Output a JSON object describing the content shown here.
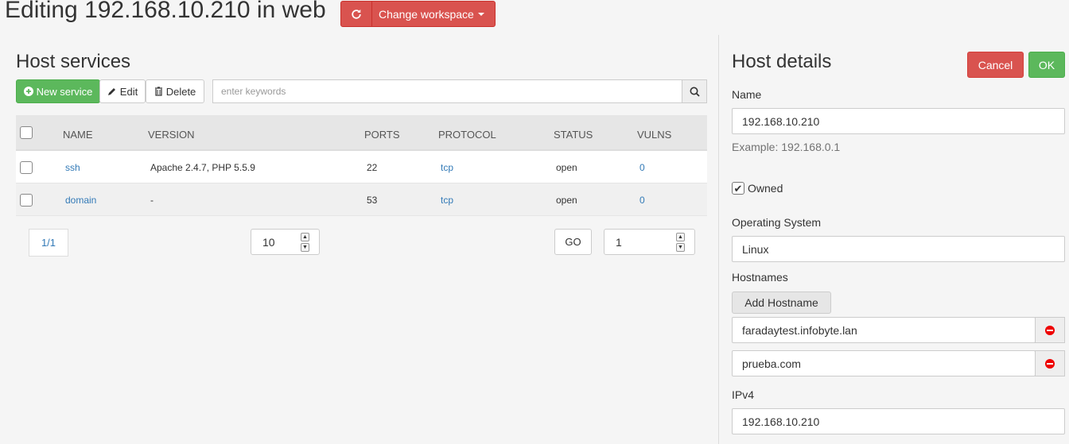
{
  "header": {
    "title": "Editing 192.168.10.210 in web",
    "workspace_button": "Change workspace"
  },
  "services": {
    "title": "Host services",
    "toolbar": {
      "new": "New service",
      "edit": "Edit",
      "delete": "Delete"
    },
    "search": {
      "placeholder": "enter keywords",
      "value": ""
    },
    "columns": [
      "NAME",
      "VERSION",
      "PORTS",
      "PROTOCOL",
      "STATUS",
      "VULNS"
    ],
    "rows": [
      {
        "name": "ssh",
        "version": "Apache 2.4.7, PHP 5.5.9",
        "ports": "22",
        "protocol": "tcp",
        "status": "open",
        "vulns": "0"
      },
      {
        "name": "domain",
        "version": "-",
        "ports": "53",
        "protocol": "tcp",
        "status": "open",
        "vulns": "0"
      }
    ],
    "pager": {
      "page": "1/1",
      "page_size": "10",
      "go": "GO",
      "go_page": "1"
    }
  },
  "details": {
    "title": "Host details",
    "cancel": "Cancel",
    "ok": "OK",
    "name_label": "Name",
    "name_value": "192.168.10.210",
    "name_help": "Example: 192.168.0.1",
    "owned_label": "Owned",
    "owned": true,
    "os_label": "Operating System",
    "os_value": "Linux",
    "hostnames_label": "Hostnames",
    "add_hostname": "Add Hostname",
    "hostnames": [
      "faradaytest.infobyte.lan",
      "prueba.com"
    ],
    "ipv4_label": "IPv4",
    "ipv4_value": "192.168.10.210"
  },
  "colors": {
    "success": "#5cb85c",
    "danger": "#d9534f",
    "link": "#337ab7"
  },
  "icons": [
    "refresh-icon",
    "caret-down-icon",
    "plus-circle-icon",
    "pencil-icon",
    "trash-icon",
    "search-icon",
    "remove-circle-icon",
    "checkmark-icon"
  ]
}
